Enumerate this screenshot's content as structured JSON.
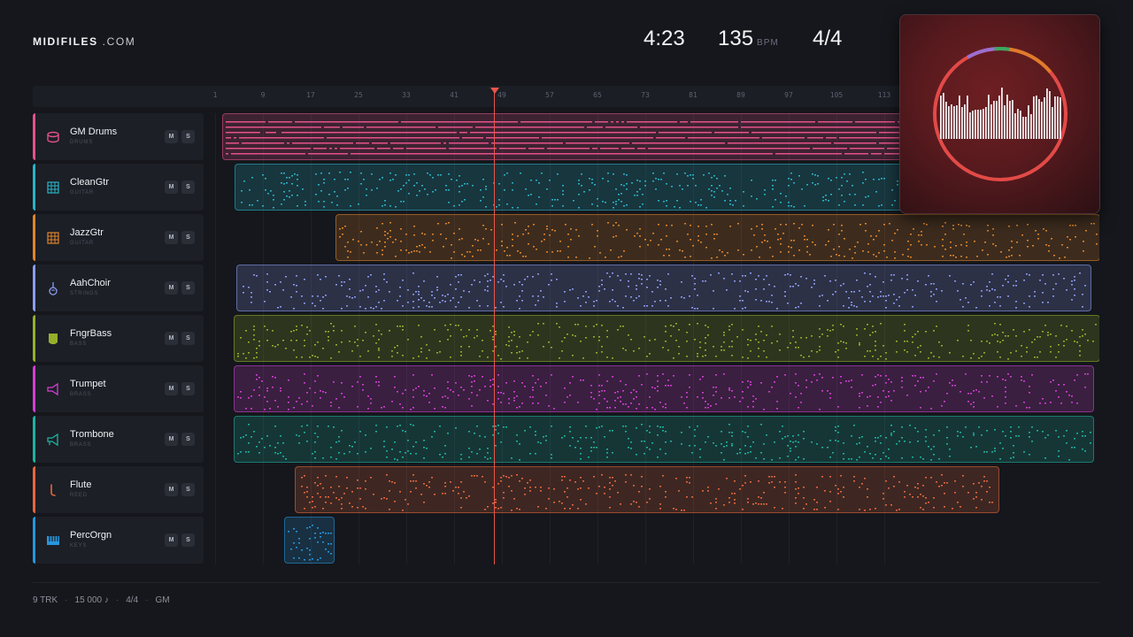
{
  "brand": {
    "name": "MIDIFILES",
    "suffix": ".COM"
  },
  "hud": {
    "time": "4:23",
    "bpm": "135",
    "bpm_unit": "BPM",
    "signature": "4/4"
  },
  "ruler": {
    "ticks": [
      "1",
      "9",
      "17",
      "25",
      "33",
      "41",
      "49",
      "57",
      "65",
      "73",
      "81",
      "89",
      "97",
      "105",
      "113"
    ]
  },
  "playback": {
    "playhead_bar": 49
  },
  "tracks": [
    {
      "name": "GM Drums",
      "category": "DRUMS",
      "color": "#e3528a",
      "icon": "drum-icon",
      "mute": "M",
      "solo": "S"
    },
    {
      "name": "CleanGtr",
      "category": "GUITAR",
      "color": "#28b3c7",
      "icon": "guitar-icon",
      "mute": "M",
      "solo": "S"
    },
    {
      "name": "JazzGtr",
      "category": "GUITAR",
      "color": "#e0842a",
      "icon": "guitar-icon",
      "mute": "M",
      "solo": "S"
    },
    {
      "name": "AahChoir",
      "category": "STRINGS",
      "color": "#8c9cf0",
      "icon": "violin-icon",
      "mute": "M",
      "solo": "S"
    },
    {
      "name": "FngrBass",
      "category": "BASS",
      "color": "#94b02a",
      "icon": "bass-icon",
      "mute": "M",
      "solo": "S"
    },
    {
      "name": "Trumpet",
      "category": "BRASS",
      "color": "#d33fd4",
      "icon": "trumpet-icon",
      "mute": "M",
      "solo": "S"
    },
    {
      "name": "Trombone",
      "category": "BRASS",
      "color": "#1fb2a0",
      "icon": "trombone-icon",
      "mute": "M",
      "solo": "S"
    },
    {
      "name": "Flute",
      "category": "REED",
      "color": "#e7673e",
      "icon": "flute-icon",
      "mute": "M",
      "solo": "S"
    },
    {
      "name": "PercOrgn",
      "category": "KEYS",
      "color": "#2796de",
      "icon": "keyboard-icon",
      "mute": "M",
      "solo": "S"
    }
  ],
  "footer": {
    "tracks": "9 TRK",
    "notes": "15 000 ♪",
    "signature": "4/4",
    "standard": "GM"
  },
  "album_art": {
    "icon": "audio-waveform-ring-icon"
  }
}
